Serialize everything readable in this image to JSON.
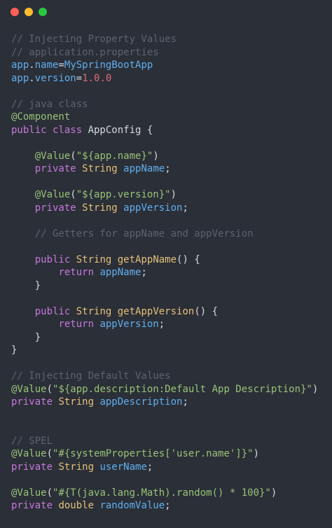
{
  "colors": {
    "background": "#2b2f37",
    "dot_red": "#ff5f57",
    "dot_yellow": "#febc2e",
    "dot_green": "#28c840",
    "comment": "#5c6370",
    "keyword": "#c678dd",
    "type": "#e5c07b",
    "function": "#e5c07b",
    "annotation": "#98c379",
    "string": "#98c379",
    "property": "#61afef",
    "number": "#e06c75",
    "plain": "#d7dae0"
  },
  "window_controls": [
    {
      "name": "close-dot",
      "color": "#ff5f57"
    },
    {
      "name": "minimize-dot",
      "color": "#febc2e"
    },
    {
      "name": "zoom-dot",
      "color": "#28c840"
    }
  ],
  "code_lines": [
    [
      {
        "t": "// Injecting Property Values",
        "c": "comment"
      }
    ],
    [
      {
        "t": "// application.properties",
        "c": "comment"
      }
    ],
    [
      {
        "t": "app",
        "c": "property"
      },
      {
        "t": ".",
        "c": "plain"
      },
      {
        "t": "name",
        "c": "property"
      },
      {
        "t": "=",
        "c": "plain"
      },
      {
        "t": "MySpringBootApp",
        "c": "property"
      }
    ],
    [
      {
        "t": "app",
        "c": "property"
      },
      {
        "t": ".",
        "c": "plain"
      },
      {
        "t": "version",
        "c": "property"
      },
      {
        "t": "=",
        "c": "plain"
      },
      {
        "t": "1.0.0",
        "c": "number"
      }
    ],
    [],
    [
      {
        "t": "// java class",
        "c": "comment"
      }
    ],
    [
      {
        "t": "@Component",
        "c": "annotation"
      }
    ],
    [
      {
        "t": "public class ",
        "c": "keyword"
      },
      {
        "t": "AppConfig {",
        "c": "plain"
      }
    ],
    [],
    [
      {
        "t": "    ",
        "c": "plain"
      },
      {
        "t": "@Value",
        "c": "annotation"
      },
      {
        "t": "(",
        "c": "plain"
      },
      {
        "t": "\"${app.name}\"",
        "c": "string"
      },
      {
        "t": ")",
        "c": "plain"
      }
    ],
    [
      {
        "t": "    ",
        "c": "plain"
      },
      {
        "t": "private ",
        "c": "keyword"
      },
      {
        "t": "String ",
        "c": "type"
      },
      {
        "t": "appName",
        "c": "property"
      },
      {
        "t": ";",
        "c": "plain"
      }
    ],
    [],
    [
      {
        "t": "    ",
        "c": "plain"
      },
      {
        "t": "@Value",
        "c": "annotation"
      },
      {
        "t": "(",
        "c": "plain"
      },
      {
        "t": "\"${app.version}\"",
        "c": "string"
      },
      {
        "t": ")",
        "c": "plain"
      }
    ],
    [
      {
        "t": "    ",
        "c": "plain"
      },
      {
        "t": "private ",
        "c": "keyword"
      },
      {
        "t": "String ",
        "c": "type"
      },
      {
        "t": "appVersion",
        "c": "property"
      },
      {
        "t": ";",
        "c": "plain"
      }
    ],
    [],
    [
      {
        "t": "    ",
        "c": "plain"
      },
      {
        "t": "// Getters for appName and appVersion",
        "c": "comment"
      }
    ],
    [],
    [
      {
        "t": "    ",
        "c": "plain"
      },
      {
        "t": "public ",
        "c": "keyword"
      },
      {
        "t": "String ",
        "c": "type"
      },
      {
        "t": "getAppName",
        "c": "function"
      },
      {
        "t": "() {",
        "c": "plain"
      }
    ],
    [
      {
        "t": "        ",
        "c": "plain"
      },
      {
        "t": "return ",
        "c": "keyword"
      },
      {
        "t": "appName",
        "c": "property"
      },
      {
        "t": ";",
        "c": "plain"
      }
    ],
    [
      {
        "t": "    }",
        "c": "plain"
      }
    ],
    [],
    [
      {
        "t": "    ",
        "c": "plain"
      },
      {
        "t": "public ",
        "c": "keyword"
      },
      {
        "t": "String ",
        "c": "type"
      },
      {
        "t": "getAppVersion",
        "c": "function"
      },
      {
        "t": "() {",
        "c": "plain"
      }
    ],
    [
      {
        "t": "        ",
        "c": "plain"
      },
      {
        "t": "return ",
        "c": "keyword"
      },
      {
        "t": "appVersion",
        "c": "property"
      },
      {
        "t": ";",
        "c": "plain"
      }
    ],
    [
      {
        "t": "    }",
        "c": "plain"
      }
    ],
    [
      {
        "t": "}",
        "c": "plain"
      }
    ],
    [],
    [
      {
        "t": "// Injecting Default Values",
        "c": "comment"
      }
    ],
    [
      {
        "t": "@Value",
        "c": "annotation"
      },
      {
        "t": "(",
        "c": "plain"
      },
      {
        "t": "\"${app.description:Default App Description}\"",
        "c": "string"
      },
      {
        "t": ")",
        "c": "plain"
      }
    ],
    [
      {
        "t": "private ",
        "c": "keyword"
      },
      {
        "t": "String ",
        "c": "type"
      },
      {
        "t": "appDescription",
        "c": "property"
      },
      {
        "t": ";",
        "c": "plain"
      }
    ],
    [],
    [],
    [
      {
        "t": "// SPEL",
        "c": "comment"
      }
    ],
    [
      {
        "t": "@Value",
        "c": "annotation"
      },
      {
        "t": "(",
        "c": "plain"
      },
      {
        "t": "\"#{systemProperties['user.name']}\"",
        "c": "string"
      },
      {
        "t": ")",
        "c": "plain"
      }
    ],
    [
      {
        "t": "private ",
        "c": "keyword"
      },
      {
        "t": "String ",
        "c": "type"
      },
      {
        "t": "userName",
        "c": "property"
      },
      {
        "t": ";",
        "c": "plain"
      }
    ],
    [],
    [
      {
        "t": "@Value",
        "c": "annotation"
      },
      {
        "t": "(",
        "c": "plain"
      },
      {
        "t": "\"#{T(java.lang.Math).random() * 100}\"",
        "c": "string"
      },
      {
        "t": ")",
        "c": "plain"
      }
    ],
    [
      {
        "t": "private ",
        "c": "keyword"
      },
      {
        "t": "double ",
        "c": "type"
      },
      {
        "t": "randomValue",
        "c": "property"
      },
      {
        "t": ";",
        "c": "plain"
      }
    ]
  ]
}
